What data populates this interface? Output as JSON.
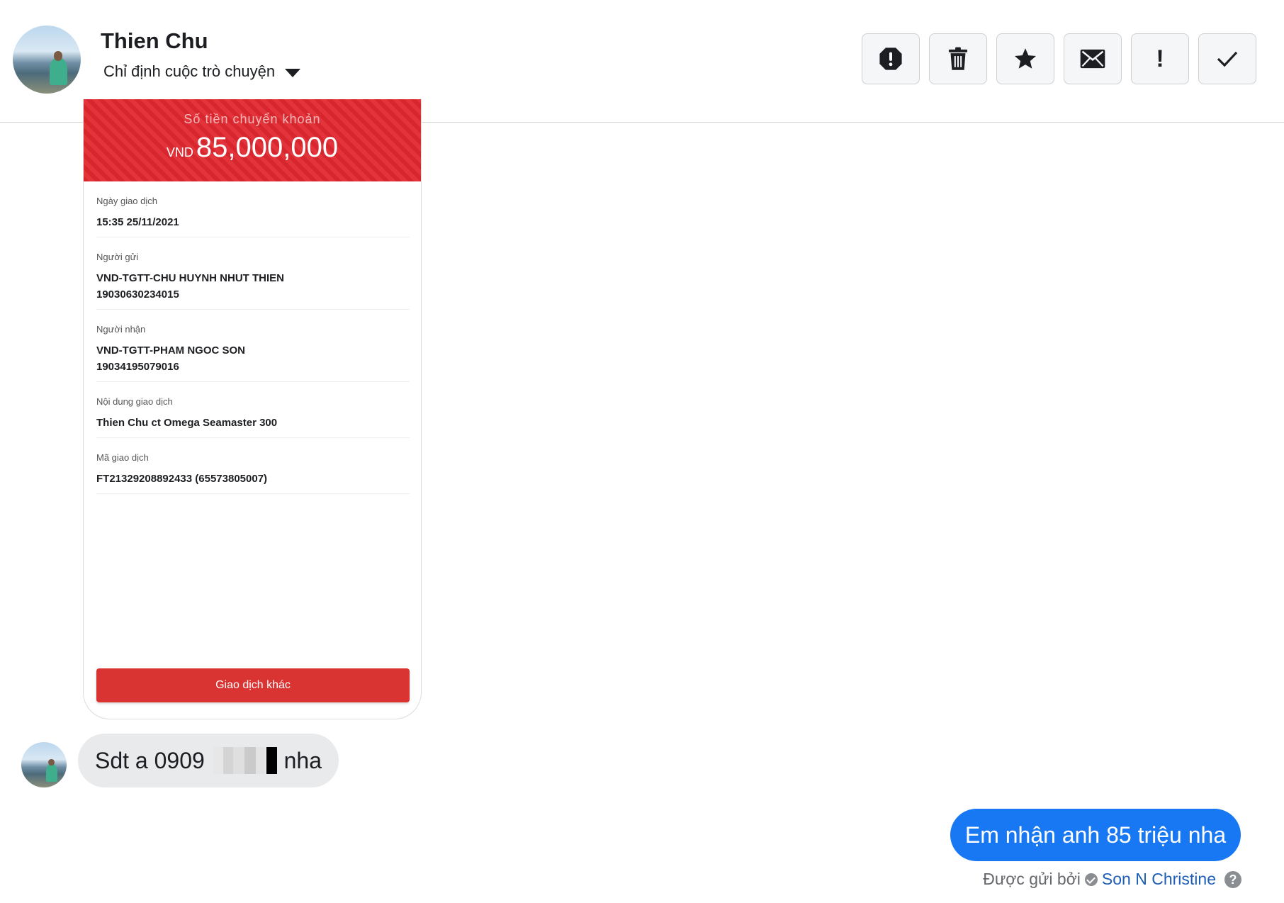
{
  "header": {
    "contact_name": "Thien Chu",
    "assign_label": "Chỉ định cuộc trò chuyện",
    "toolbar": [
      {
        "icon": "alert-octagon-icon"
      },
      {
        "icon": "trash-icon"
      },
      {
        "icon": "star-icon"
      },
      {
        "icon": "envelope-icon"
      },
      {
        "icon": "exclamation-icon",
        "glyph": "!"
      },
      {
        "icon": "checkmark-icon"
      }
    ]
  },
  "receipt": {
    "header_text": "Số tiền chuyển khoản",
    "currency": "VND",
    "amount": "85,000,000",
    "rows": [
      {
        "label": "Ngày giao dịch",
        "value": "15:35 25/11/2021"
      },
      {
        "label": "Người gửi",
        "value": "VND-TGTT-CHU HUYNH NHUT THIEN",
        "value2": "19030630234015"
      },
      {
        "label": "Người nhận",
        "value": "VND-TGTT-PHAM NGOC SON",
        "value2": "19034195079016"
      },
      {
        "label": "Nội dung giao dịch",
        "value": "Thien Chu ct Omega Seamaster 300"
      },
      {
        "label": "Mã giao dịch",
        "value": "FT21329208892433 (65573805007)"
      }
    ],
    "button_label": "Giao dịch khác",
    "colors": {
      "accent": "#da3432"
    }
  },
  "messages": {
    "incoming": {
      "prefix": "Sdt a 0909",
      "suffix": "nha"
    },
    "outgoing": {
      "text": "Em nhận anh 85 triệu nha"
    },
    "sent_by_label": "Được gửi bởi",
    "sender_name": "Son N Christine"
  },
  "colors": {
    "outgoing_bubble": "#1877f2",
    "incoming_bubble": "#e9eaec"
  }
}
